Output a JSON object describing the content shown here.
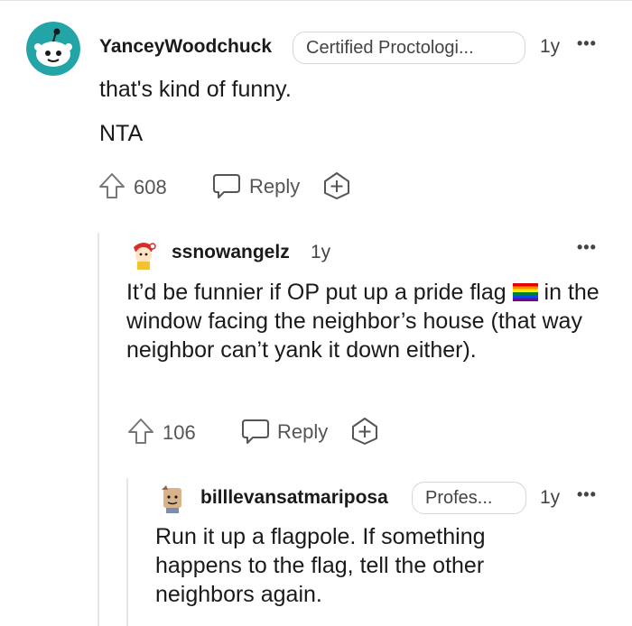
{
  "comments": [
    {
      "username": "YanceyWoodchuck",
      "flair": "Certified Proctologi...",
      "age": "1y",
      "body": [
        "that's kind of funny.",
        "NTA"
      ],
      "votes": "608",
      "reply_label": "Reply"
    },
    {
      "username": "ssnowangelz",
      "age": "1y",
      "body_before_flag": "It’d be funnier if OP put up a pride flag ",
      "body_after_flag": " in the window facing the neighbor’s house (that way neighbor can’t yank it down either).",
      "votes": "106",
      "reply_label": "Reply"
    },
    {
      "username": "billlevansatmariposa",
      "flair": "Profes...",
      "age": "1y",
      "body": "Run it up a flagpole. If something happens to the flag, tell the other neighbors again."
    }
  ],
  "icons": {
    "more": "more-options-icon",
    "upvote": "upvote-arrow-icon",
    "reply": "speech-bubble-icon",
    "award": "award-plus-icon"
  },
  "colors": {
    "avatar_teal": "#23a4a6",
    "text": "#1a1a1b",
    "muted": "#555555"
  }
}
